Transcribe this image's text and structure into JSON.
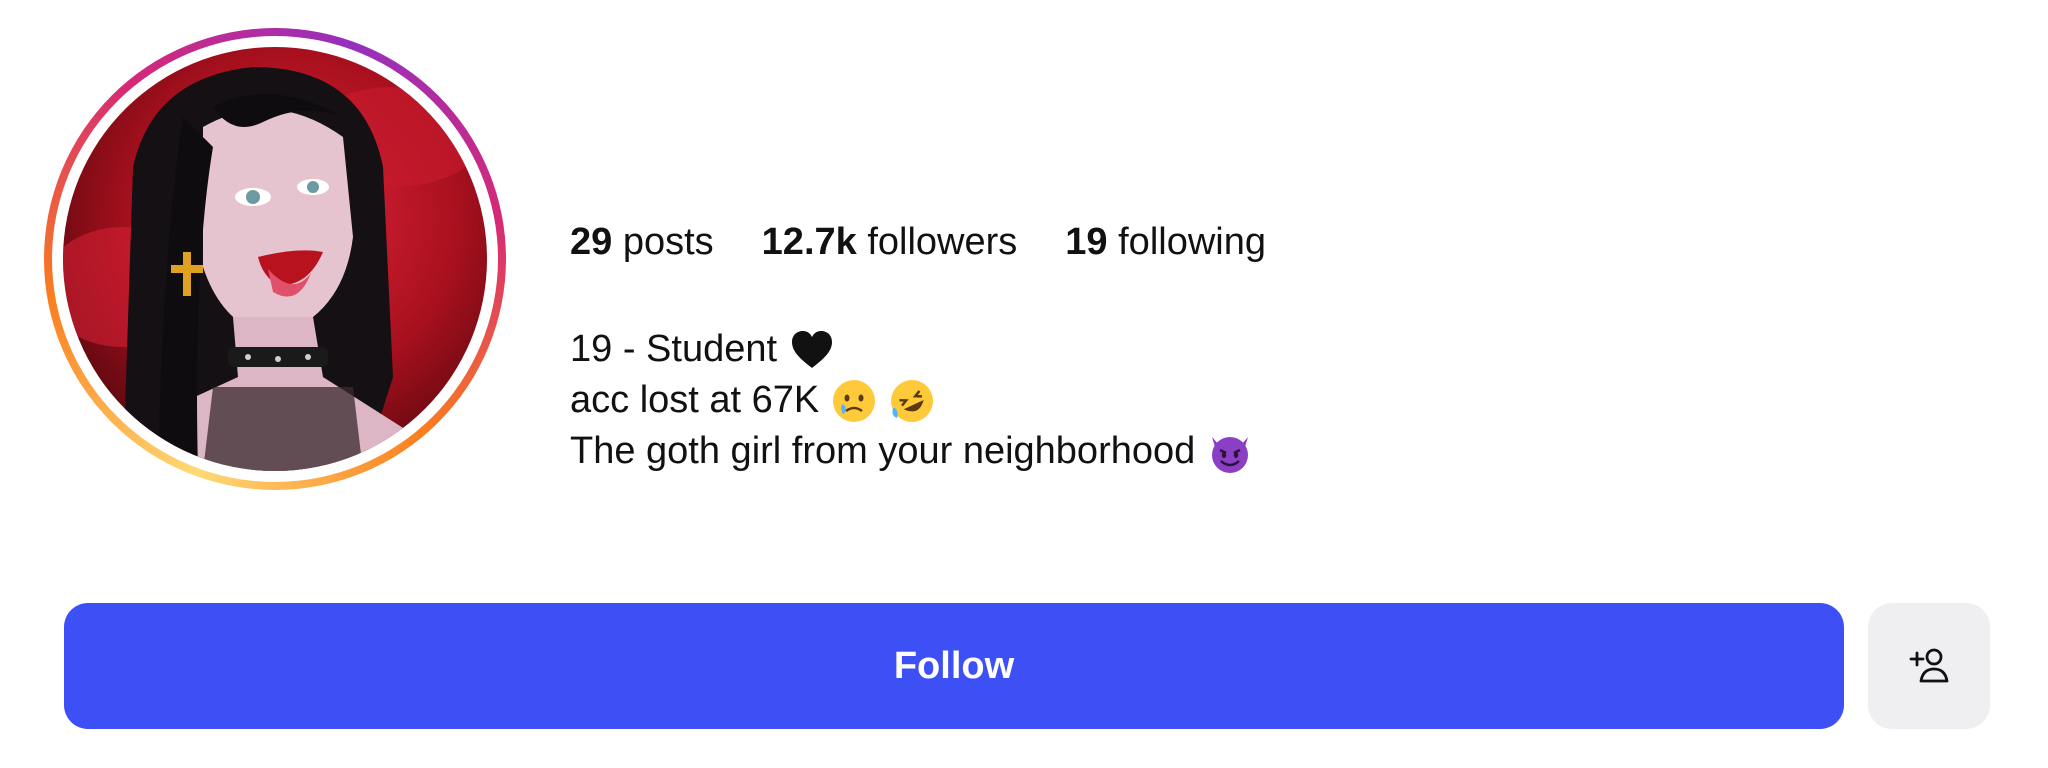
{
  "profile": {
    "stats": {
      "posts_count": "29",
      "posts_label": "posts",
      "followers_count": "12.7k",
      "followers_label": "followers",
      "following_count": "19",
      "following_label": "following"
    },
    "bio": {
      "line1": "19 - Student",
      "line1_emoji": "black-heart-icon",
      "line2": "acc lost at 67K",
      "line2_emojis": [
        "crying-face-icon",
        "rolling-laughing-face-icon"
      ],
      "line3": "The goth girl from your neighborhood",
      "line3_emoji": "smiling-devil-icon"
    },
    "avatar": "avatar-goth-girl-illustration",
    "story_ring": true
  },
  "actions": {
    "follow_label": "Follow",
    "add_user_icon": "add-user-icon"
  },
  "colors": {
    "follow_button": "#3d50f5",
    "secondary_button": "#efeff1",
    "ring_gradient": [
      "#feda75",
      "#fa7e1e",
      "#d62976",
      "#962fbf"
    ]
  }
}
